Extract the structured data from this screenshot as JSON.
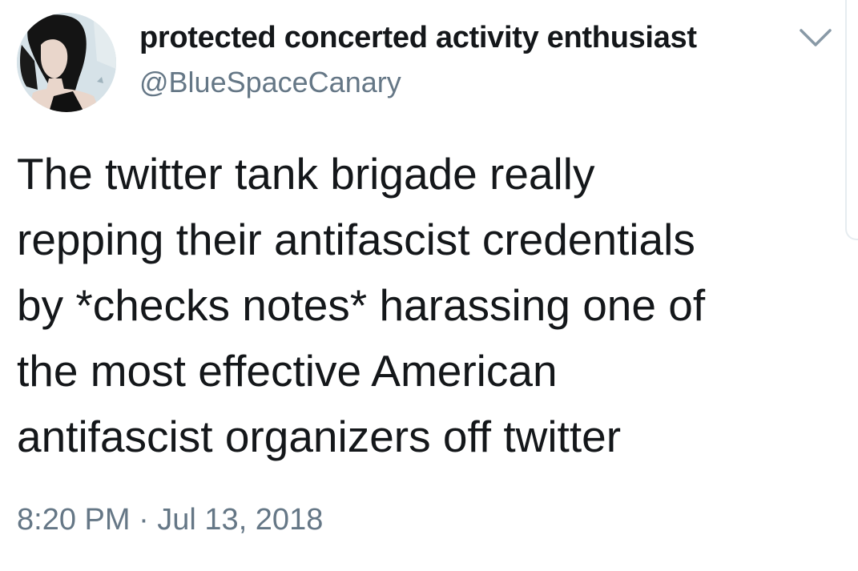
{
  "tweet": {
    "author": {
      "display_name": "protected concerted activity enthusiast",
      "handle": "@BlueSpaceCanary",
      "avatar_icon": "profile-avatar"
    },
    "menu_icon": "chevron-down-icon",
    "text_lines": [
      "The twitter tank brigade really",
      "repping their antifascist credentials",
      "by *checks notes* harassing one of",
      "the most effective American",
      "antifascist organizers off twitter"
    ],
    "timestamp": "8:20 PM · Jul 13, 2018"
  },
  "colors": {
    "primary_text": "#14171a",
    "secondary_text": "#657786",
    "border": "#e6ecf0",
    "background": "#ffffff"
  }
}
